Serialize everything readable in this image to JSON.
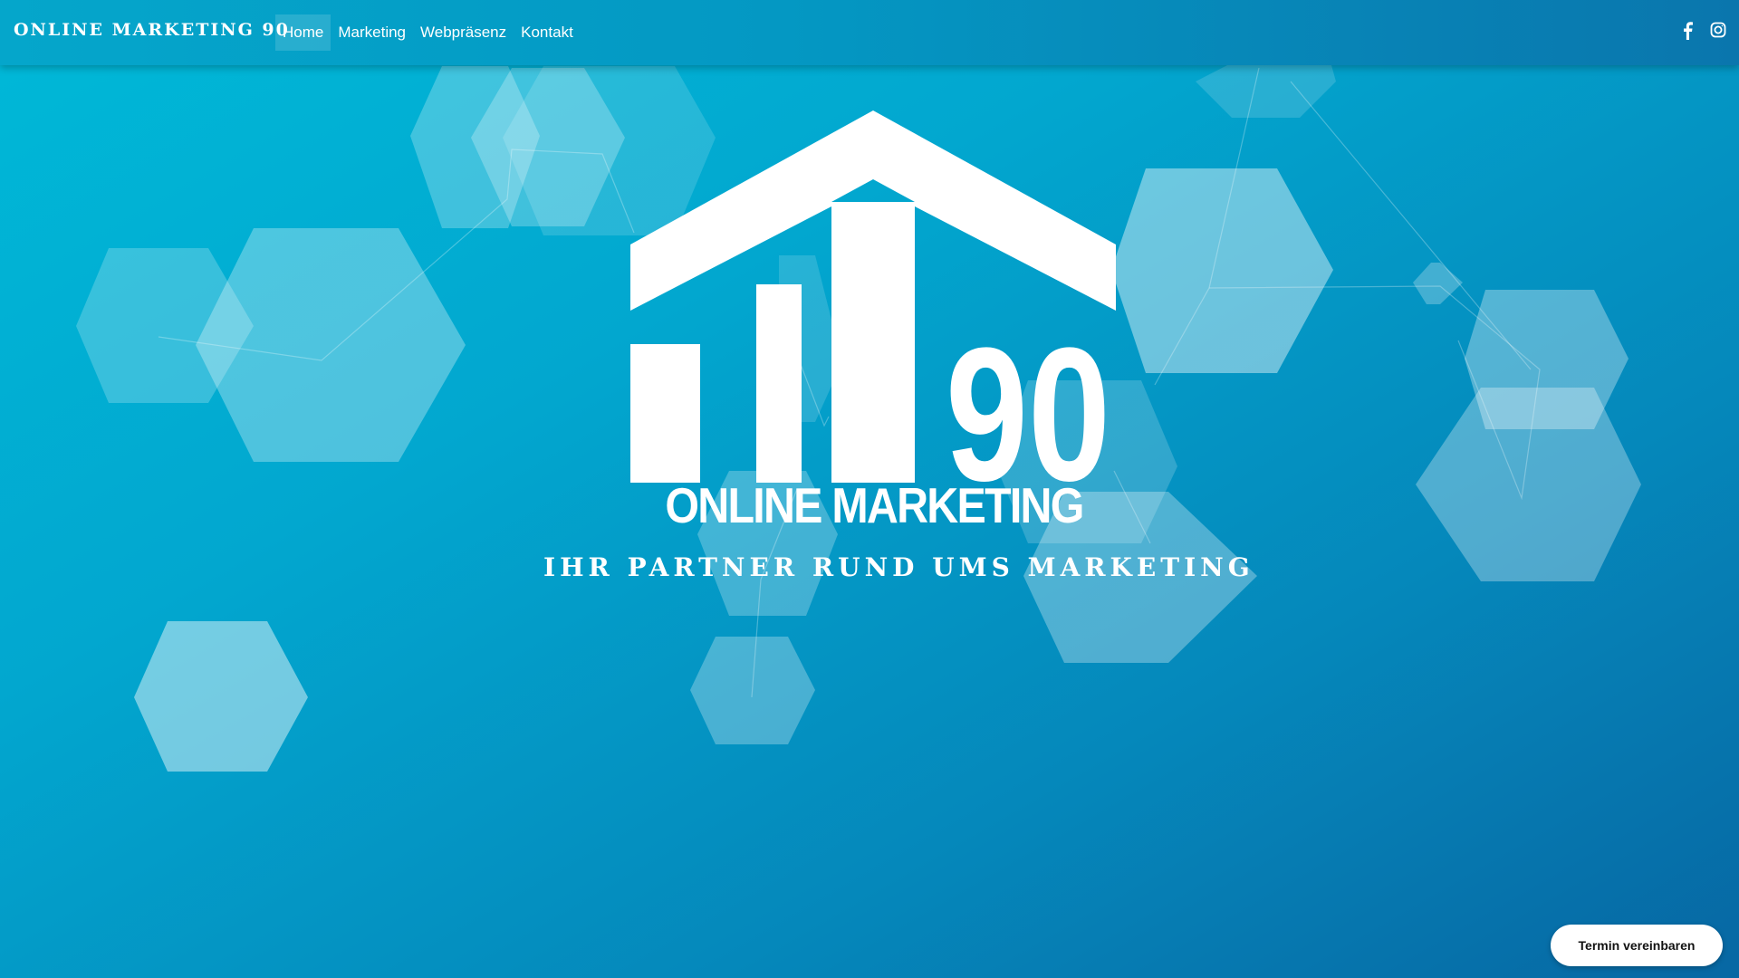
{
  "header": {
    "brand": "ONLINE MARKETING 90",
    "nav": [
      {
        "label": "Home",
        "active": true
      },
      {
        "label": "Marketing",
        "active": false
      },
      {
        "label": "Webpräsenz",
        "active": false
      },
      {
        "label": "Kontakt",
        "active": false
      }
    ],
    "social": [
      {
        "icon": "facebook-icon"
      },
      {
        "icon": "instagram-icon"
      }
    ]
  },
  "hero": {
    "logo_number": "90",
    "logo_text": "ONLINE MARKETING",
    "tagline": "IHR PARTNER RUND UMS MARKETING"
  },
  "cta": {
    "label": "Termin vereinbaren"
  },
  "colors": {
    "background_start": "#00b9d8",
    "background_end": "#0767a3",
    "foreground": "#ffffff"
  }
}
